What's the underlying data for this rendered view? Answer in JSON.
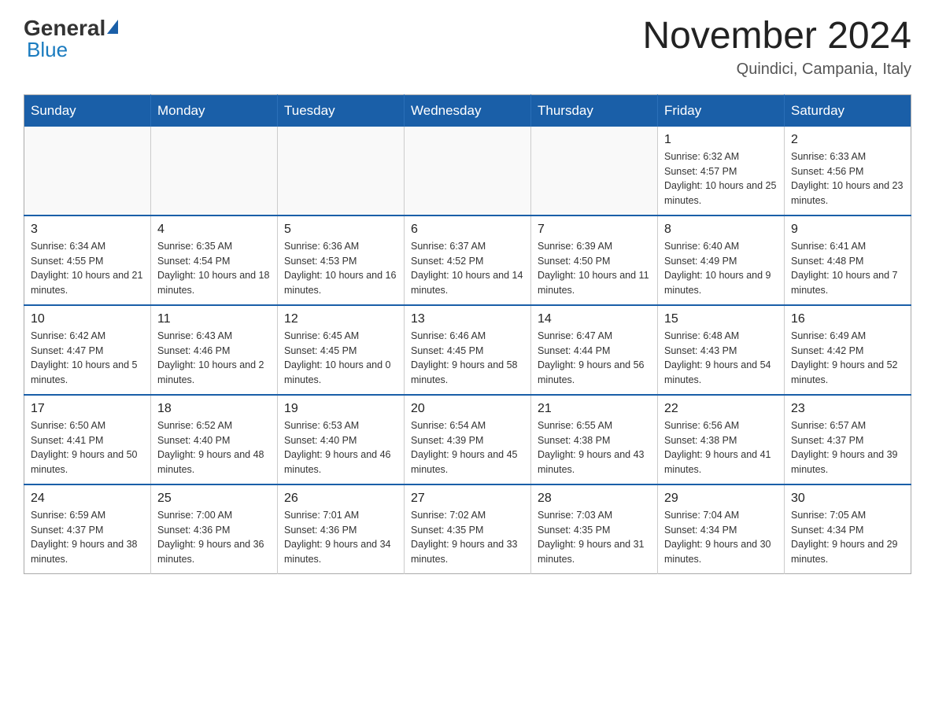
{
  "header": {
    "logo": {
      "general": "General",
      "blue": "Blue"
    },
    "title": "November 2024",
    "subtitle": "Quindici, Campania, Italy"
  },
  "days_of_week": [
    "Sunday",
    "Monday",
    "Tuesday",
    "Wednesday",
    "Thursday",
    "Friday",
    "Saturday"
  ],
  "weeks": [
    {
      "days": [
        {
          "num": "",
          "info": ""
        },
        {
          "num": "",
          "info": ""
        },
        {
          "num": "",
          "info": ""
        },
        {
          "num": "",
          "info": ""
        },
        {
          "num": "",
          "info": ""
        },
        {
          "num": "1",
          "info": "Sunrise: 6:32 AM\nSunset: 4:57 PM\nDaylight: 10 hours and 25 minutes."
        },
        {
          "num": "2",
          "info": "Sunrise: 6:33 AM\nSunset: 4:56 PM\nDaylight: 10 hours and 23 minutes."
        }
      ]
    },
    {
      "days": [
        {
          "num": "3",
          "info": "Sunrise: 6:34 AM\nSunset: 4:55 PM\nDaylight: 10 hours and 21 minutes."
        },
        {
          "num": "4",
          "info": "Sunrise: 6:35 AM\nSunset: 4:54 PM\nDaylight: 10 hours and 18 minutes."
        },
        {
          "num": "5",
          "info": "Sunrise: 6:36 AM\nSunset: 4:53 PM\nDaylight: 10 hours and 16 minutes."
        },
        {
          "num": "6",
          "info": "Sunrise: 6:37 AM\nSunset: 4:52 PM\nDaylight: 10 hours and 14 minutes."
        },
        {
          "num": "7",
          "info": "Sunrise: 6:39 AM\nSunset: 4:50 PM\nDaylight: 10 hours and 11 minutes."
        },
        {
          "num": "8",
          "info": "Sunrise: 6:40 AM\nSunset: 4:49 PM\nDaylight: 10 hours and 9 minutes."
        },
        {
          "num": "9",
          "info": "Sunrise: 6:41 AM\nSunset: 4:48 PM\nDaylight: 10 hours and 7 minutes."
        }
      ]
    },
    {
      "days": [
        {
          "num": "10",
          "info": "Sunrise: 6:42 AM\nSunset: 4:47 PM\nDaylight: 10 hours and 5 minutes."
        },
        {
          "num": "11",
          "info": "Sunrise: 6:43 AM\nSunset: 4:46 PM\nDaylight: 10 hours and 2 minutes."
        },
        {
          "num": "12",
          "info": "Sunrise: 6:45 AM\nSunset: 4:45 PM\nDaylight: 10 hours and 0 minutes."
        },
        {
          "num": "13",
          "info": "Sunrise: 6:46 AM\nSunset: 4:45 PM\nDaylight: 9 hours and 58 minutes."
        },
        {
          "num": "14",
          "info": "Sunrise: 6:47 AM\nSunset: 4:44 PM\nDaylight: 9 hours and 56 minutes."
        },
        {
          "num": "15",
          "info": "Sunrise: 6:48 AM\nSunset: 4:43 PM\nDaylight: 9 hours and 54 minutes."
        },
        {
          "num": "16",
          "info": "Sunrise: 6:49 AM\nSunset: 4:42 PM\nDaylight: 9 hours and 52 minutes."
        }
      ]
    },
    {
      "days": [
        {
          "num": "17",
          "info": "Sunrise: 6:50 AM\nSunset: 4:41 PM\nDaylight: 9 hours and 50 minutes."
        },
        {
          "num": "18",
          "info": "Sunrise: 6:52 AM\nSunset: 4:40 PM\nDaylight: 9 hours and 48 minutes."
        },
        {
          "num": "19",
          "info": "Sunrise: 6:53 AM\nSunset: 4:40 PM\nDaylight: 9 hours and 46 minutes."
        },
        {
          "num": "20",
          "info": "Sunrise: 6:54 AM\nSunset: 4:39 PM\nDaylight: 9 hours and 45 minutes."
        },
        {
          "num": "21",
          "info": "Sunrise: 6:55 AM\nSunset: 4:38 PM\nDaylight: 9 hours and 43 minutes."
        },
        {
          "num": "22",
          "info": "Sunrise: 6:56 AM\nSunset: 4:38 PM\nDaylight: 9 hours and 41 minutes."
        },
        {
          "num": "23",
          "info": "Sunrise: 6:57 AM\nSunset: 4:37 PM\nDaylight: 9 hours and 39 minutes."
        }
      ]
    },
    {
      "days": [
        {
          "num": "24",
          "info": "Sunrise: 6:59 AM\nSunset: 4:37 PM\nDaylight: 9 hours and 38 minutes."
        },
        {
          "num": "25",
          "info": "Sunrise: 7:00 AM\nSunset: 4:36 PM\nDaylight: 9 hours and 36 minutes."
        },
        {
          "num": "26",
          "info": "Sunrise: 7:01 AM\nSunset: 4:36 PM\nDaylight: 9 hours and 34 minutes."
        },
        {
          "num": "27",
          "info": "Sunrise: 7:02 AM\nSunset: 4:35 PM\nDaylight: 9 hours and 33 minutes."
        },
        {
          "num": "28",
          "info": "Sunrise: 7:03 AM\nSunset: 4:35 PM\nDaylight: 9 hours and 31 minutes."
        },
        {
          "num": "29",
          "info": "Sunrise: 7:04 AM\nSunset: 4:34 PM\nDaylight: 9 hours and 30 minutes."
        },
        {
          "num": "30",
          "info": "Sunrise: 7:05 AM\nSunset: 4:34 PM\nDaylight: 9 hours and 29 minutes."
        }
      ]
    }
  ]
}
